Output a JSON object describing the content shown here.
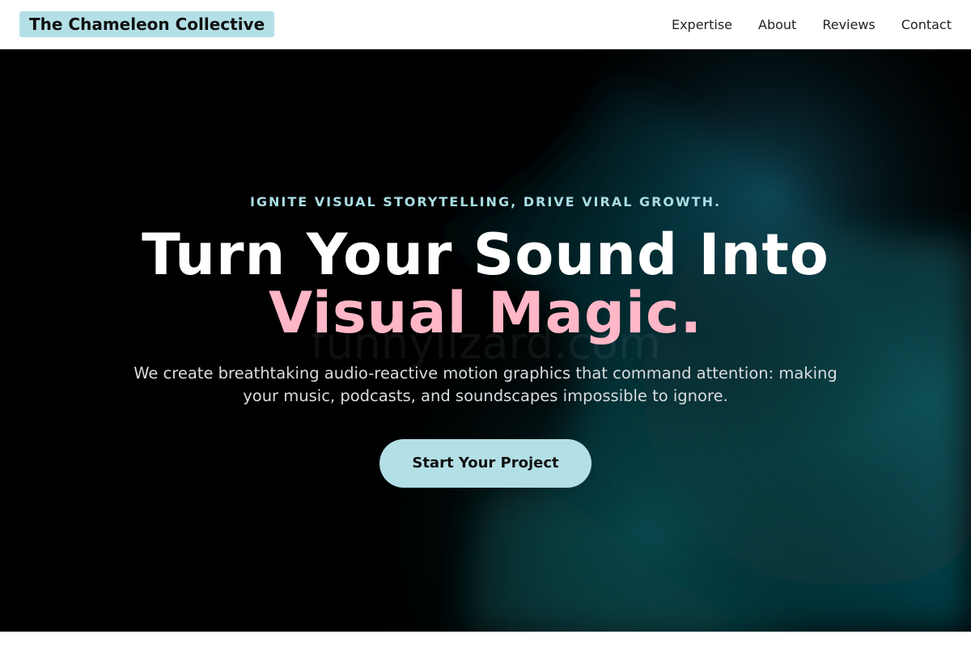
{
  "header": {
    "brand": "The Chameleon Collective",
    "nav": [
      {
        "label": "Expertise"
      },
      {
        "label": "About"
      },
      {
        "label": "Reviews"
      },
      {
        "label": "Contact"
      }
    ]
  },
  "hero": {
    "eyebrow": "IGNITE VISUAL STORYTELLING, DRIVE VIRAL GROWTH.",
    "headline_line1": "Turn Your Sound Into",
    "headline_accent": "Visual Magic.",
    "watermark": "funnylizard.com",
    "subtitle": "We create breathtaking audio-reactive motion graphics that command attention: making your music, podcasts, and soundscapes impossible to ignore.",
    "cta_label": "Start Your Project"
  },
  "colors": {
    "brand_bg": "#b3e0e6",
    "accent_pink": "#ffb6c6",
    "eyebrow": "#a9dde4",
    "hero_bg": "#000000",
    "hero_glow": "#0a5a5e"
  }
}
